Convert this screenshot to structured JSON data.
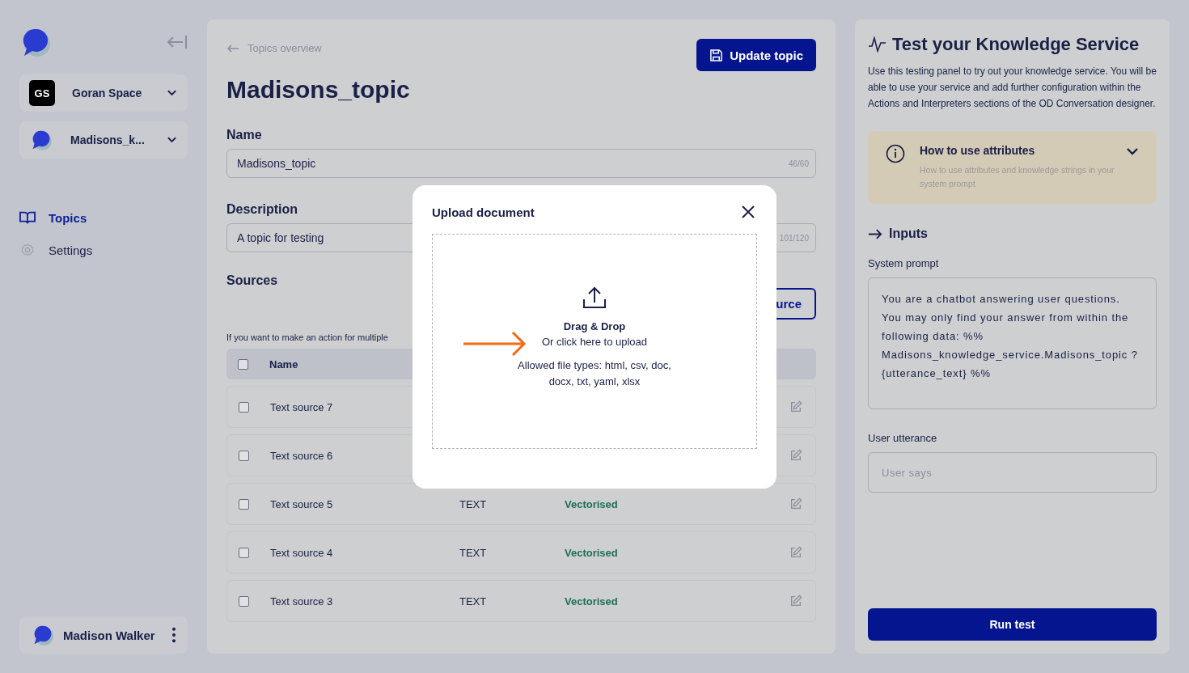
{
  "sidebar": {
    "workspace": {
      "initials": "GS",
      "name": "Goran Space"
    },
    "service": {
      "name": "Madisons_k..."
    },
    "nav": [
      {
        "label": "Topics",
        "kind": "book",
        "selected": true
      },
      {
        "label": "Settings",
        "kind": "gear",
        "selected": false
      }
    ],
    "user": {
      "name": "Madison Walker"
    }
  },
  "main": {
    "breadcrumb": "Topics overview",
    "update_button": "Update topic",
    "title": "Madisons_topic",
    "name_field": {
      "label": "Name",
      "value": "Madisons_topic",
      "counter": "46/60"
    },
    "description_field": {
      "label": "Description",
      "value": "A topic for testing",
      "counter": "101/120"
    },
    "sources": {
      "title": "Sources",
      "add_button": "urce",
      "hint": "If you want to make an action for multiple",
      "header": {
        "checked": false,
        "columns": [
          "Name"
        ]
      },
      "rows": [
        {
          "name": "Text source 7",
          "checked": false
        },
        {
          "name": "Text source 6",
          "checked": false
        },
        {
          "name": "Text source 5",
          "type": "TEXT",
          "status": "Vectorised",
          "checked": false
        },
        {
          "name": "Text source 4",
          "type": "TEXT",
          "status": "Vectorised",
          "checked": false
        },
        {
          "name": "Text source 3",
          "type": "TEXT",
          "status": "Vectorised",
          "checked": false
        }
      ]
    }
  },
  "modal": {
    "title": "Upload document",
    "drop_title": "Drag & Drop",
    "drop_subtitle": "Or click here to upload",
    "allowed": "Allowed file types: html, csv, doc, docx, txt, yaml, xlsx"
  },
  "test_panel": {
    "title": "Test your Knowledge Service",
    "description": "Use this testing panel to try out your knowledge service. You will be able to use your service and add further configuration within the Actions and Interpreters sections of the OD Conversation designer.",
    "info": {
      "title": "How to use attributes",
      "text": "How to use attributes and knowledge strings in your system prompt",
      "expanded": false
    },
    "inputs_title": "Inputs",
    "system_prompt": {
      "label": "System prompt",
      "value": "You are a chatbot answering user questions. You may only find your answer from within the following data: %% Madisons_knowledge_service.Madisons_topic ? {utterance_text} %%"
    },
    "utterance": {
      "label": "User utterance",
      "placeholder": "User says"
    },
    "run_button": "Run test"
  }
}
